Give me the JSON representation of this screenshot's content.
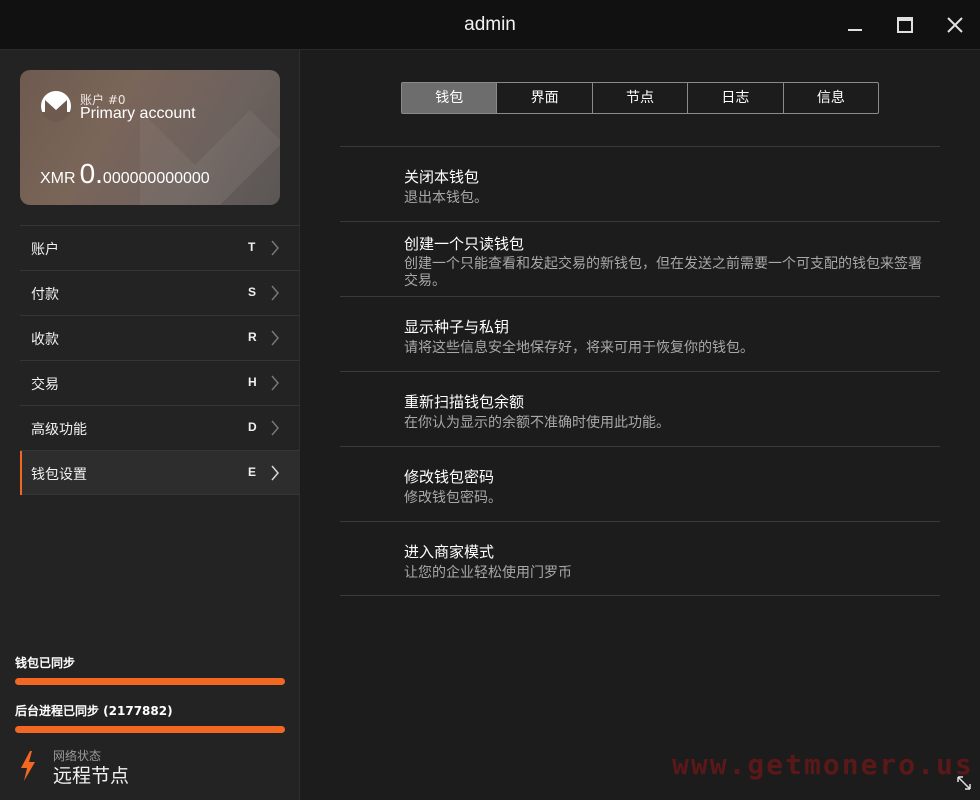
{
  "window": {
    "title": "admin"
  },
  "account_card": {
    "account_number": "账户 #0",
    "account_name": "Primary account",
    "currency": "XMR",
    "balance_integer": "0.",
    "balance_fraction": "000000000000"
  },
  "sidebar": {
    "items": [
      {
        "label": "账户",
        "shortcut": "T",
        "active": false
      },
      {
        "label": "付款",
        "shortcut": "S",
        "active": false
      },
      {
        "label": "收款",
        "shortcut": "R",
        "active": false
      },
      {
        "label": "交易",
        "shortcut": "H",
        "active": false
      },
      {
        "label": "高级功能",
        "shortcut": "D",
        "active": false
      },
      {
        "label": "钱包设置",
        "shortcut": "E",
        "active": true
      }
    ],
    "wallet_sync_label": "钱包已同步",
    "daemon_sync_label": "后台进程已同步 (2177882)",
    "network_caption": "网络状态",
    "network_value": "远程节点"
  },
  "tabs": [
    {
      "label": "钱包",
      "active": true
    },
    {
      "label": "界面",
      "active": false
    },
    {
      "label": "节点",
      "active": false
    },
    {
      "label": "日志",
      "active": false
    },
    {
      "label": "信息",
      "active": false
    }
  ],
  "settings": [
    {
      "title": "关闭本钱包",
      "description": "退出本钱包。"
    },
    {
      "title": "创建一个只读钱包",
      "description": "创建一个只能查看和发起交易的新钱包，但在发送之前需要一个可支配的钱包来签署交易。"
    },
    {
      "title": "显示种子与私钥",
      "description": "请将这些信息安全地保存好，将来可用于恢复你的钱包。"
    },
    {
      "title": "重新扫描钱包余额",
      "description": "在你认为显示的余额不准确时使用此功能。"
    },
    {
      "title": "修改钱包密码",
      "description": "修改钱包密码。"
    },
    {
      "title": "进入商家模式",
      "description": "让您的企业轻松使用门罗币"
    }
  ],
  "watermark": "www.getmonero.us",
  "colors": {
    "accent": "#f26822",
    "background": "#1c1c1c",
    "sidebar": "#232323"
  }
}
